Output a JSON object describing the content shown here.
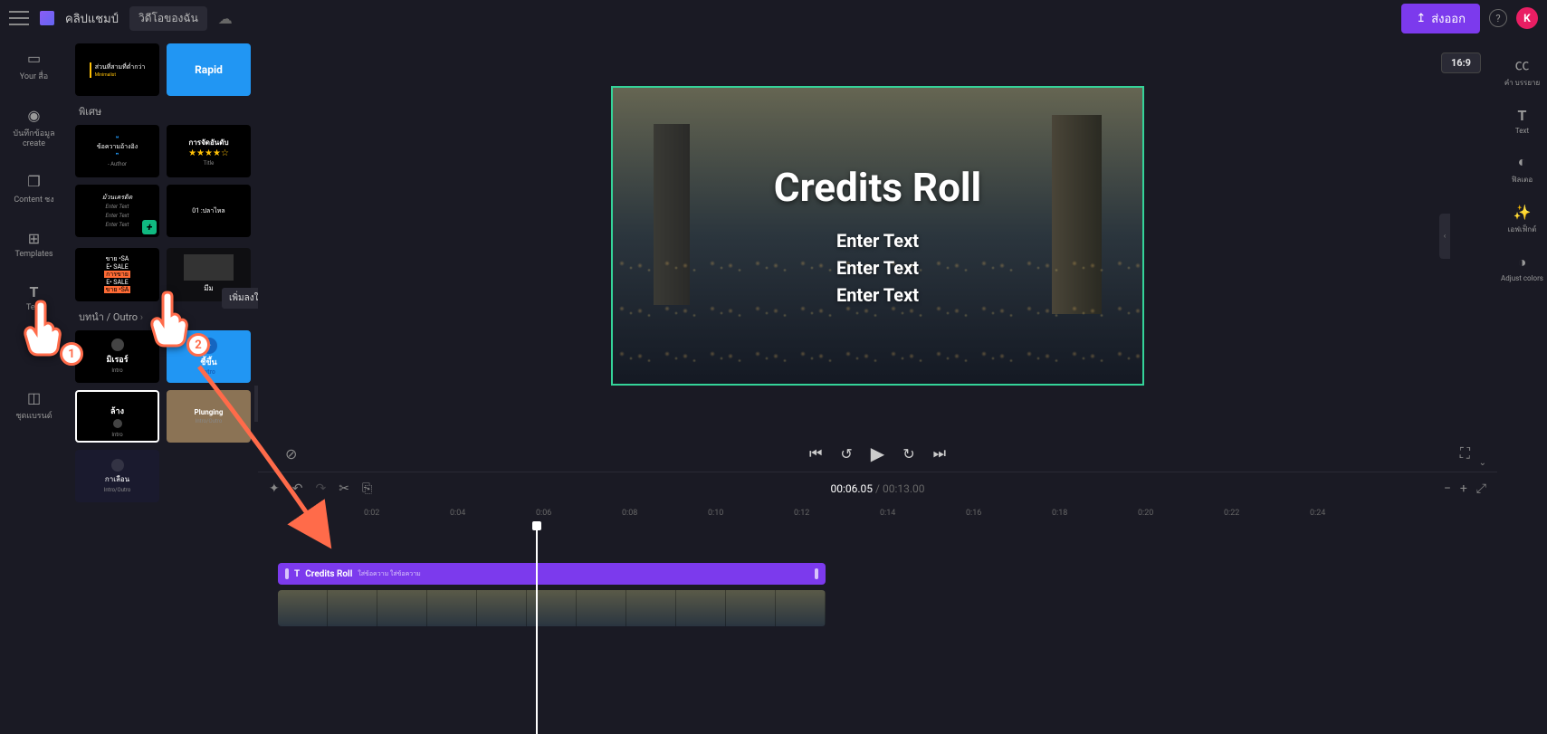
{
  "topbar": {
    "brand": "คลิปแชมป์",
    "my_videos": "วิดีโอของฉัน",
    "export": "ส่งออก",
    "avatar_letter": "K"
  },
  "leftnav": {
    "your_media": "Your สื่อ",
    "record": "บันทึกข้อมูล create",
    "content": "Content ชง",
    "templates": "Templates",
    "text": "Text",
    "brandkit": "ชุดแบรนด์"
  },
  "panel": {
    "section_special": "พิเศษ",
    "section_intro": "บทนำ / Outro",
    "tpl_minimalist_line1": "ส่วนที่สามที่ต่ำกว่า",
    "tpl_minimalist_line2": "Minimalist",
    "tpl_rapid": "Rapid",
    "tpl_quote_text": "ข้อความอ้างอิง",
    "tpl_quote_author": "- Author",
    "tpl_rank_title": "การจัดอันดับ",
    "tpl_rank_sub": "Title",
    "tpl_credits_title": "ม้วนเครดิต",
    "tpl_credits_sub": "Enter Text",
    "tpl_fish": "01 :ปลาไหล",
    "tpl_add_tooltip": "เพิ่มลงในไทม์ไลน์",
    "tpl_sale1": "ขาย •SA",
    "tpl_sale2": "E• SALE",
    "tpl_sale3": "การขาย",
    "tpl_meme": "มีม",
    "tpl_mirror": "มิเรอร์",
    "tpl_mirror_sub": "Intro",
    "tpl_point": "ชี้ขึ้น",
    "tpl_point_sub": "Intro",
    "tpl_box": "ล้าง",
    "tpl_box_sub": "Intro",
    "tpl_plunging": "Plunging",
    "tpl_plunging_sub": "Intro/Outro",
    "tpl_earth": "กาเลือน",
    "tpl_earth_sub": "Intro/Outro"
  },
  "canvas": {
    "title": "Credits Roll",
    "line1": "Enter Text",
    "line2": "Enter Text",
    "line3": "Enter Text",
    "aspect": "16:9"
  },
  "rightprops": {
    "captions": "คำ บรรยาย",
    "text": "Text",
    "filters": "ฟิลเตอ",
    "effects": "เอฟเฟ็กต์",
    "colors": "Adjust colors"
  },
  "timeline": {
    "current": "00:06.05",
    "duration": "00:13.00",
    "ticks": [
      "0:02",
      "0:04",
      "0:06",
      "0:08",
      "0:10",
      "0:12",
      "0:14",
      "0:16",
      "0:18",
      "0:20",
      "0:22",
      "0:24"
    ],
    "clip_label": "Credits Roll",
    "clip_micro": "ใส่ข้อความ ใส่ข้อความ"
  }
}
